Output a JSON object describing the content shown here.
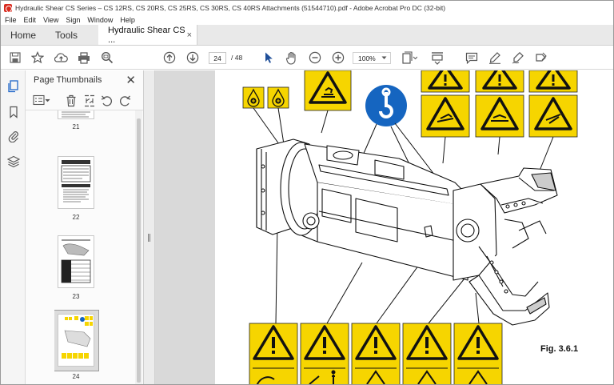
{
  "window": {
    "title": "Hydraulic Shear CS Series – CS 12RS, CS 20RS, CS 25RS, CS 30RS, CS 40RS Attachments (51544710).pdf - Adobe Acrobat Pro DC (32-bit)"
  },
  "menu": [
    "File",
    "Edit",
    "View",
    "Sign",
    "Window",
    "Help"
  ],
  "tabs": {
    "home": "Home",
    "tools": "Tools",
    "document": "Hydraulic Shear CS ...",
    "close": "×"
  },
  "toolbar": {
    "current_page": "24",
    "total_pages": "/ 48",
    "zoom": "100%"
  },
  "thumbnails_panel": {
    "title": "Page Thumbnails",
    "close": "✕",
    "pages": [
      {
        "label": "21"
      },
      {
        "label": "22"
      },
      {
        "label": "23"
      },
      {
        "label": "24",
        "selected": true
      }
    ]
  },
  "document": {
    "figure_caption": "Fig. 3.6.1"
  },
  "colors": {
    "warning_yellow": "#f6d500",
    "info_blue": "#1565c0",
    "acrobat_red": "#d92b1f"
  }
}
